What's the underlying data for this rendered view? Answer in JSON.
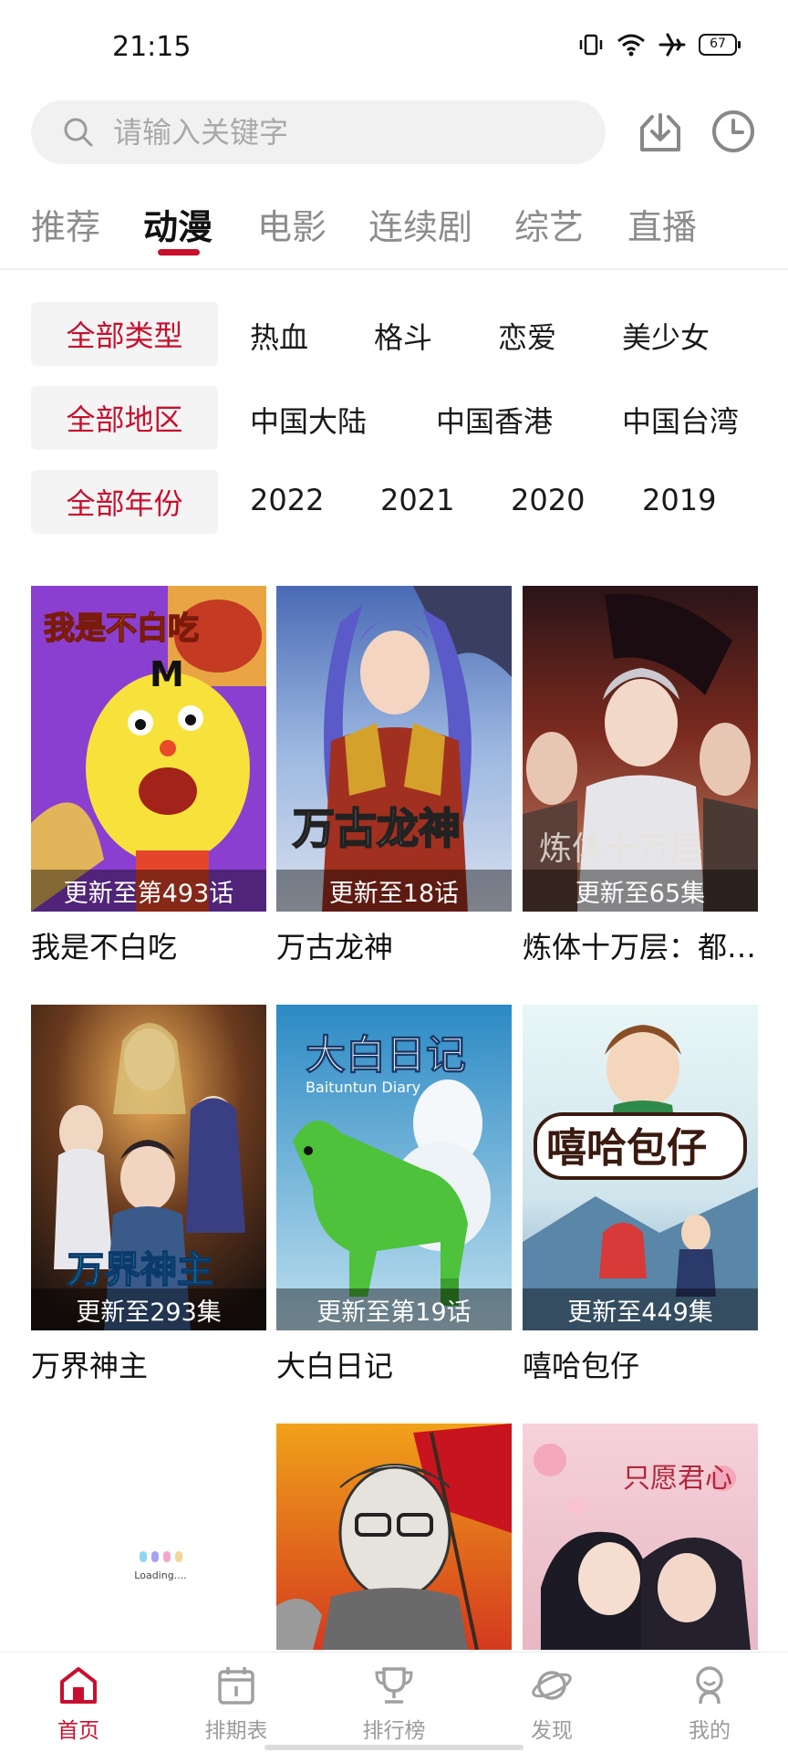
{
  "status_bar": {
    "time": "21:15",
    "battery": "67"
  },
  "search": {
    "placeholder": "请输入关键字"
  },
  "tabs": [
    {
      "label": "推荐",
      "active": false
    },
    {
      "label": "动漫",
      "active": true
    },
    {
      "label": "电影",
      "active": false
    },
    {
      "label": "连续剧",
      "active": false
    },
    {
      "label": "综艺",
      "active": false
    },
    {
      "label": "直播",
      "active": false
    }
  ],
  "filters": {
    "type": {
      "all": "全部类型",
      "options": [
        "热血",
        "格斗",
        "恋爱",
        "美少女"
      ]
    },
    "region": {
      "all": "全部地区",
      "options": [
        "中国大陆",
        "中国香港",
        "中国台湾"
      ]
    },
    "year": {
      "all": "全部年份",
      "options": [
        "2022",
        "2021",
        "2020",
        "2019"
      ]
    }
  },
  "cards": [
    {
      "title": "我是不白吃",
      "update": "更新至第493话",
      "poster_text": "我是不白吃"
    },
    {
      "title": "万古龙神",
      "update": "更新至18话",
      "poster_text": "万古龙神"
    },
    {
      "title": "炼体十万层：都…",
      "update": "更新至65集",
      "poster_text": "炼体十万层"
    },
    {
      "title": "万界神主",
      "update": "更新至293集",
      "poster_text": "万界神主"
    },
    {
      "title": "大白日记",
      "update": "更新至第19话",
      "poster_text": "大白日记"
    },
    {
      "title": "嘻哈包仔",
      "update": "更新至449集",
      "poster_text": "嘻哈包仔"
    }
  ],
  "loading_text": "Loading....",
  "bottom_nav": [
    {
      "label": "首页",
      "icon": "home-icon",
      "active": true
    },
    {
      "label": "排期表",
      "icon": "calendar-icon",
      "active": false
    },
    {
      "label": "排行榜",
      "icon": "trophy-icon",
      "active": false
    },
    {
      "label": "发现",
      "icon": "planet-icon",
      "active": false
    },
    {
      "label": "我的",
      "icon": "profile-icon",
      "active": false
    }
  ],
  "colors": {
    "accent": "#c8102e",
    "tab_inactive": "#8c8c8c",
    "filter_bg": "#f4f4f4"
  }
}
